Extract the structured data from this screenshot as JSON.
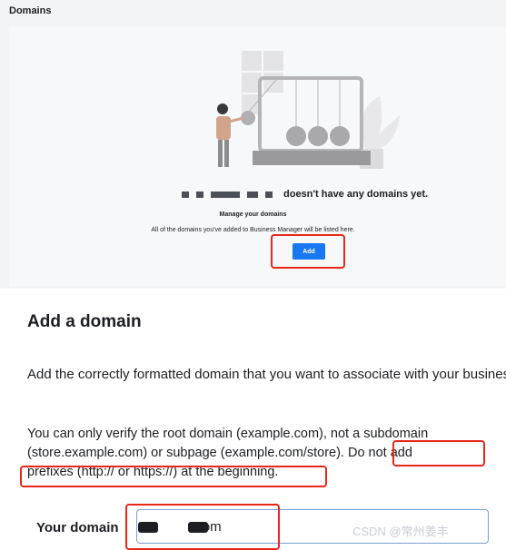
{
  "header": {
    "title": "Domains"
  },
  "empty_state": {
    "no_domains_text": "doesn't have any domains yet.",
    "manage_title": "Manage your domains",
    "description": "All of the domains you've added to Business Manager will be listed here.",
    "add_button_label": "Add"
  },
  "add_domain": {
    "title": "Add a domain",
    "paragraph1": "Add the correctly formatted domain that you want to associate with your business.",
    "paragraph2_line1": "You can only verify the root domain (example.com), not a subdomain",
    "paragraph2_line2": "(store.example.com) or subpage (example.com/store). Do not add",
    "paragraph2_line3": "prefixes (http:// or https://) at the beginning.",
    "domain_label": "Your domain",
    "domain_value": "r.com"
  },
  "watermark": "CSDN @常州姜丰",
  "colors": {
    "accent": "#1877f2",
    "highlight": "#e8261a"
  }
}
